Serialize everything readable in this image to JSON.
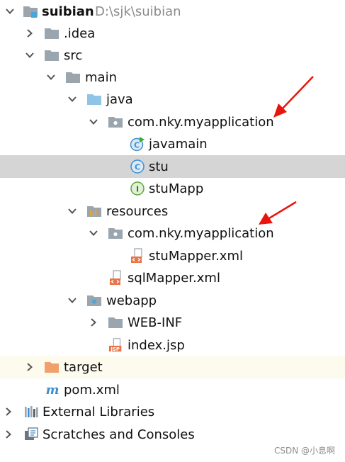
{
  "project": {
    "name": "suibian",
    "path": "D:\\sjk\\suibian"
  },
  "tree": {
    "idea": ".idea",
    "src": "src",
    "main": "main",
    "java": "java",
    "java_package": "com.nky.myapplication",
    "javamain": "javamain",
    "stu": "stu",
    "stuMapp": "stuMapp",
    "resources": "resources",
    "res_package": "com.nky.myapplication",
    "stuMapper_xml": "stuMapper.xml",
    "sqlMapper_xml": "sqlMapper.xml",
    "webapp": "webapp",
    "webinf": "WEB-INF",
    "index_jsp": "index.jsp",
    "target": "target",
    "pom_xml": "pom.xml",
    "external_libraries": "External Libraries",
    "scratches": "Scratches and Consoles"
  },
  "icon_glyphs": {
    "class": "C",
    "interface": "I",
    "maven": "m",
    "jsp": "JSP"
  },
  "watermark": "CSDN @小息啊",
  "colors": {
    "folder_gray": "#9aa5ae",
    "source_folder": "#8fc4e6",
    "class_blue": "#3f8fd0",
    "interface_green": "#5aa83a",
    "xml_orange": "#e8754a",
    "target_folder": "#f0a06a",
    "maven_blue": "#3f8fd0",
    "annotation_red": "#e8150c",
    "selected_row": "#d5d5d5"
  }
}
